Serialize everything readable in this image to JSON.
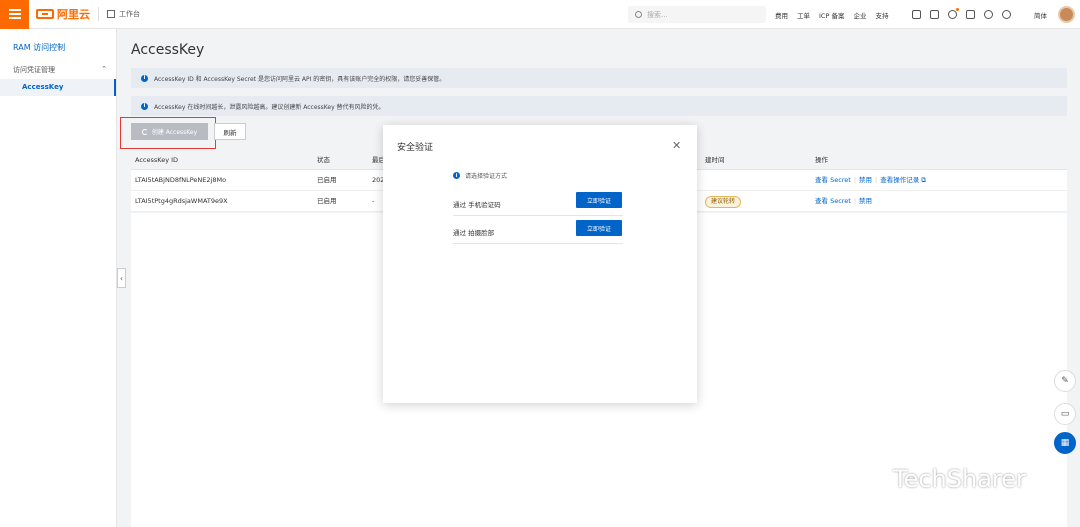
{
  "topbar": {
    "logo": "阿里云",
    "workbench": "工作台",
    "search_placeholder": "搜索...",
    "nav": [
      "费用",
      "工单",
      "ICP 备案",
      "企业",
      "支持"
    ],
    "language": "简体",
    "brand_color": "#ff6a00"
  },
  "sidebar": {
    "title": "RAM 访问控制",
    "group": "访问凭证管理",
    "active_item": "AccessKey"
  },
  "main": {
    "title": "AccessKey",
    "notices": [
      "AccessKey ID 和 AccessKey Secret 是您访问阿里云 API 的密钥，具有该账户完全的权限，请您妥善保管。",
      "AccessKey 在线时间越长，泄露风险越高。建议创建新 AccessKey 替代有风险的凭。"
    ],
    "create_button": "创建 AccessKey",
    "refresh_button": "刷新",
    "table": {
      "headers": {
        "id": "AccessKey ID",
        "status": "状态",
        "created": "最后",
        "last_used": "建时间",
        "actions": "操作"
      },
      "rows": [
        {
          "id": "LTAI5tABjND8fNLPeNE2j8Mo",
          "status": "已启用",
          "created": "202",
          "actions": [
            "查看 Secret",
            "禁用",
            "查看操作记录"
          ]
        },
        {
          "id": "LTAI5tPtg4gRdsjaWMAT9e9X",
          "status": "已启用",
          "created": "-",
          "tag": "建议轮转",
          "actions": [
            "查看 Secret",
            "禁用"
          ]
        }
      ]
    }
  },
  "modal": {
    "title": "安全验证",
    "hint": "请选择验证方式",
    "options": [
      {
        "label": "通过 手机验证码",
        "button": "立即验证"
      },
      {
        "label": "通过 拍摄脸部",
        "button": "立即验证"
      }
    ]
  },
  "watermark": "TechSharer",
  "accent_color": "#0064c8"
}
